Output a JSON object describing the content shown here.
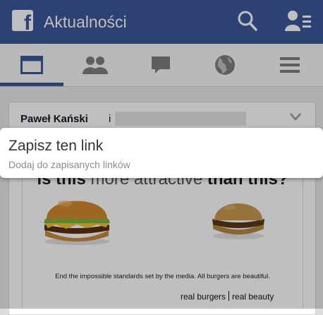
{
  "topbar": {
    "title": "Aktualności",
    "logo_letter": "f",
    "icons": [
      "facebook-logo-icon",
      "search-icon",
      "friend-requests-icon"
    ]
  },
  "tabs": [
    {
      "name": "news-feed",
      "icon": "news-feed-icon",
      "active": true
    },
    {
      "name": "friends",
      "icon": "friends-icon",
      "active": false
    },
    {
      "name": "messages",
      "icon": "chat-icon",
      "active": false
    },
    {
      "name": "notifications",
      "icon": "globe-icon",
      "active": false
    },
    {
      "name": "more",
      "icon": "menu-icon",
      "active": false
    }
  ],
  "post": {
    "author": "Paweł Kański",
    "author_suffix": "i",
    "image": {
      "headline_part1": "is this",
      "headline_part2": "more attractive",
      "headline_part3": "than this?",
      "caption": "End the impossible standards set by the media. All burgers are beautiful.",
      "tagline_left": "real burgers",
      "tagline_right": "real beauty"
    }
  },
  "context_menu": {
    "title": "Zapisz ten link",
    "subtitle": "Dodaj do zapisanych linków"
  },
  "colors": {
    "brand": "#3b5998",
    "feed_bg": "#e9eaed"
  }
}
